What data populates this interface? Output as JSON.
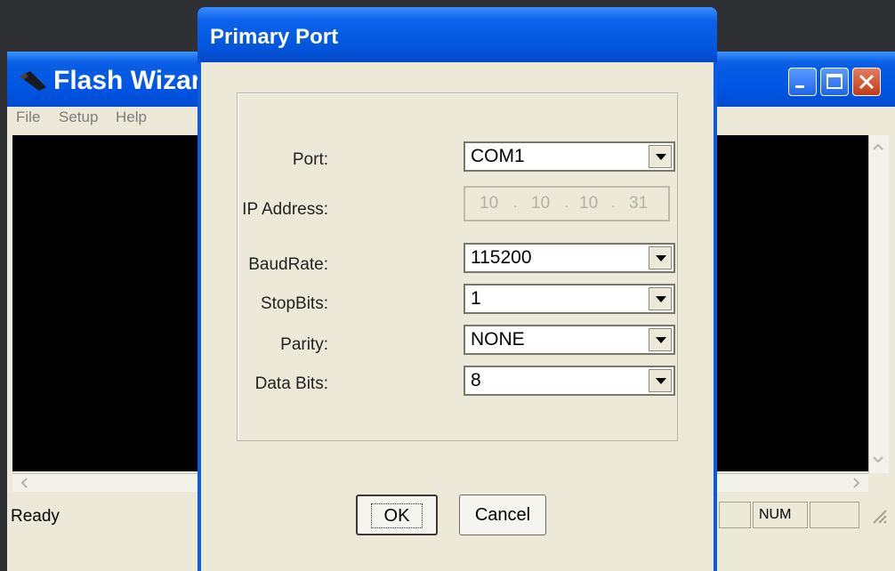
{
  "background_window": {
    "title": "Flash Wizard",
    "app_icon": "wand-icon",
    "menu": [
      "File",
      "Setup",
      "Help"
    ],
    "status_text": "Ready",
    "status_panes": [
      "NUM"
    ],
    "window_buttons": [
      "minimize-icon",
      "maximize-icon",
      "close-icon"
    ]
  },
  "dialog": {
    "title": "Primary Port",
    "fields": {
      "port": {
        "label": "Port:",
        "value": "COM1"
      },
      "ip_address": {
        "label": "IP Address:",
        "octets": [
          "10",
          "10",
          "10",
          "31"
        ]
      },
      "baudrate": {
        "label": "BaudRate:",
        "value": "115200"
      },
      "stopbits": {
        "label": "StopBits:",
        "value": "1"
      },
      "parity": {
        "label": "Parity:",
        "value": "NONE"
      },
      "databits": {
        "label": "Data Bits:",
        "value": "8"
      }
    },
    "buttons": {
      "ok": "OK",
      "cancel": "Cancel"
    }
  },
  "colors": {
    "title_bar": "#0055e5",
    "dialog_face": "#ece9d8",
    "canvas": "#000000"
  }
}
